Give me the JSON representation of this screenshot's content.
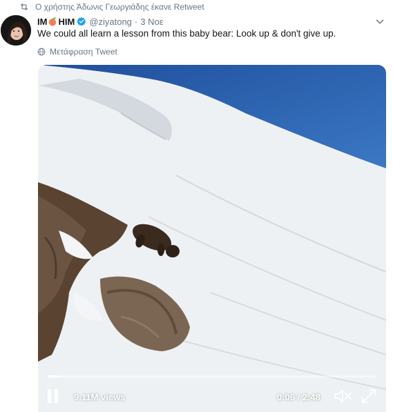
{
  "retweet": {
    "text": "Ο χρήστης Άδωνις Γεωργιάδης έκανε Retweet",
    "icon": "retweet-icon"
  },
  "tweet": {
    "name_prefix": "IM",
    "name_suffix": "HIM",
    "name_emoji": "peach-icon",
    "handle": "@ziyatong",
    "dot": "·",
    "time": "3 Νοε",
    "text": "We could all learn a lesson from this baby bear: Look up & don't give up.",
    "translate_label": "Μετάφραση Tweet"
  },
  "video": {
    "views": "9.11M views",
    "timecode": "0:06 / 2:48",
    "progress": 0.036
  },
  "colors": {
    "secondary_text": "#657786",
    "verified_blue": "#1da1f2",
    "sky_blue": "#2d64b4"
  }
}
